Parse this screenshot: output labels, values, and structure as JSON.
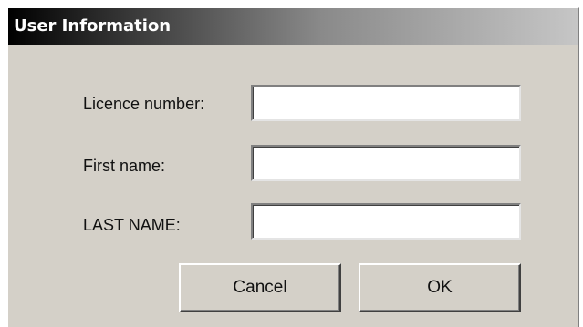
{
  "dialog": {
    "title": "User Information"
  },
  "form": {
    "licence_label": "Licence number:",
    "licence_value": "",
    "first_name_label": "First name:",
    "first_name_value": "",
    "last_name_label": "LAST NAME:",
    "last_name_value": ""
  },
  "buttons": {
    "cancel_label": "Cancel",
    "ok_label": "OK"
  }
}
